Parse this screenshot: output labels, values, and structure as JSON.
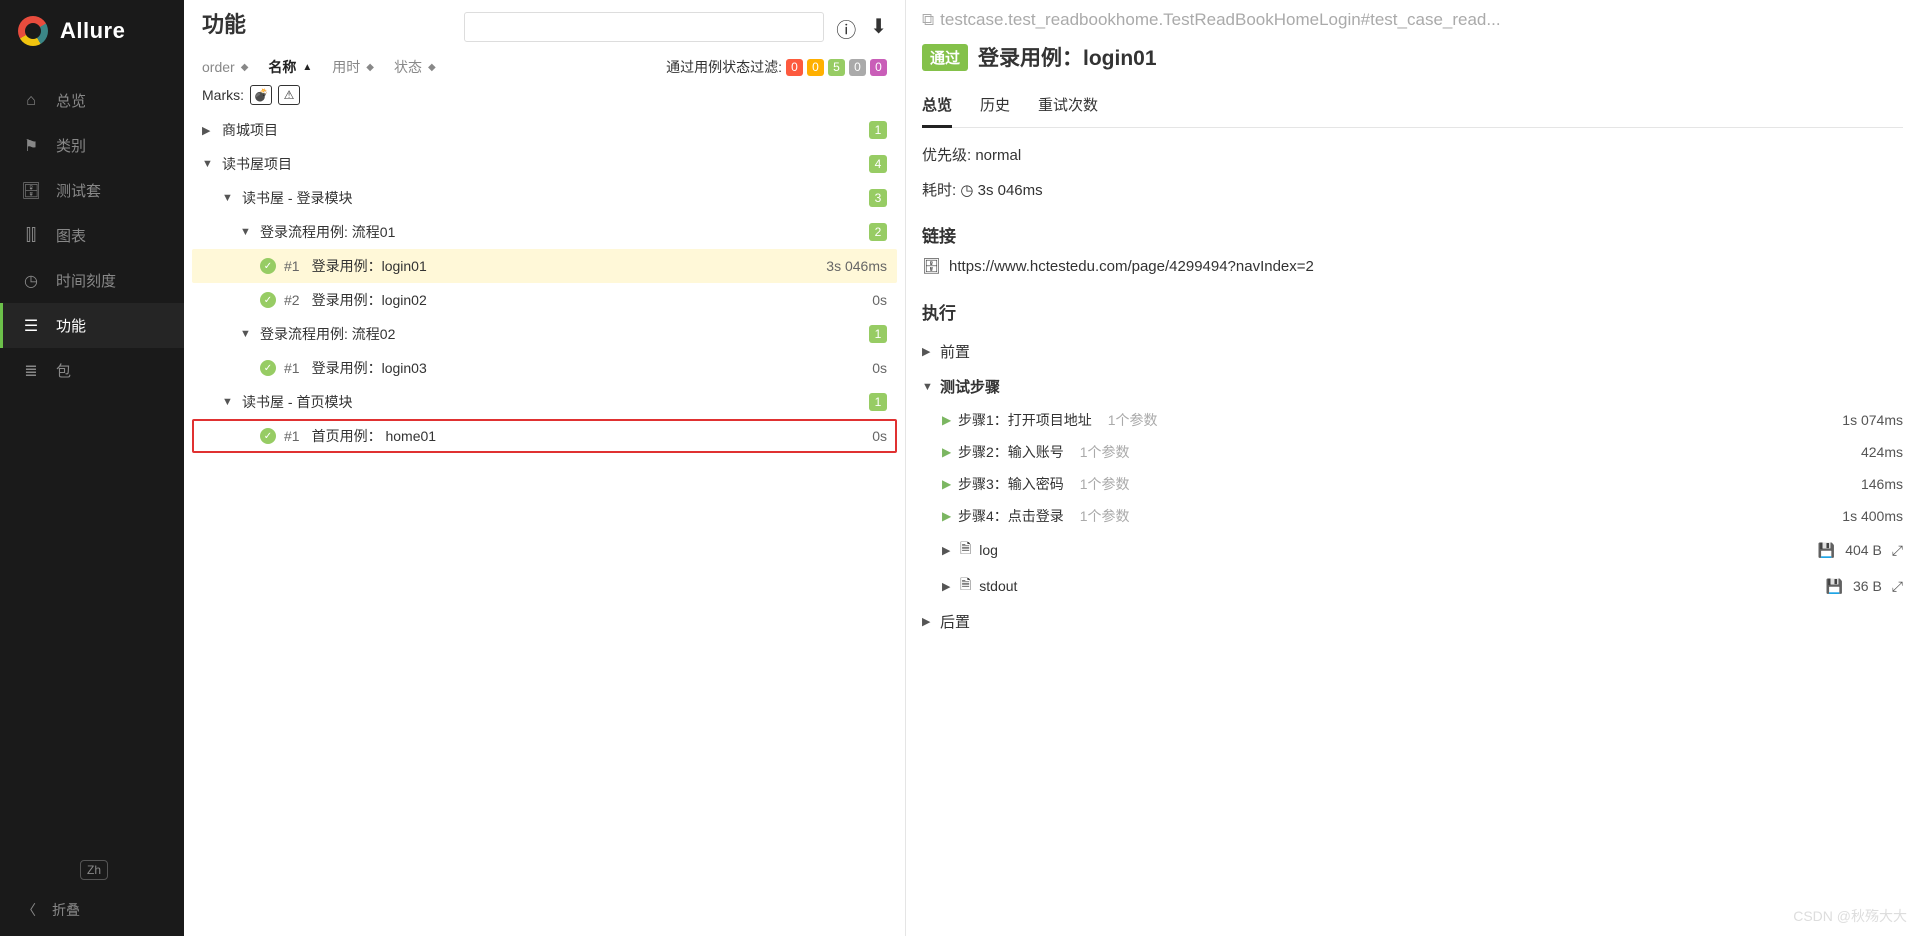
{
  "sidebar": {
    "brand": "Allure",
    "items": [
      {
        "label": "总览",
        "icon": "home"
      },
      {
        "label": "类别",
        "icon": "flag"
      },
      {
        "label": "测试套",
        "icon": "case"
      },
      {
        "label": "图表",
        "icon": "chart"
      },
      {
        "label": "时间刻度",
        "icon": "clock"
      },
      {
        "label": "功能",
        "icon": "list",
        "active": true
      },
      {
        "label": "包",
        "icon": "stack"
      }
    ],
    "lang": "Zh",
    "collapse": "折叠"
  },
  "mid": {
    "title": "功能",
    "sort": {
      "order": "order",
      "name": "名称",
      "duration": "用时",
      "status": "状态"
    },
    "filter": {
      "label": "通过用例状态过滤:",
      "counts": [
        "0",
        "0",
        "5",
        "0",
        "0"
      ]
    },
    "marks_label": "Marks:",
    "tree": {
      "n0": {
        "name": "商城项目",
        "badge": "1"
      },
      "n1": {
        "name": "读书屋项目",
        "badge": "4"
      },
      "n2": {
        "name": "读书屋 - 登录模块",
        "badge": "3"
      },
      "n3": {
        "name": "登录流程用例: 流程01",
        "badge": "2"
      },
      "n4": {
        "num": "#1",
        "name": "登录用例：login01",
        "meta": "3s 046ms"
      },
      "n5": {
        "num": "#2",
        "name": "登录用例：login02",
        "meta": "0s"
      },
      "n6": {
        "name": "登录流程用例: 流程02",
        "badge": "1"
      },
      "n7": {
        "num": "#1",
        "name": "登录用例：login03",
        "meta": "0s"
      },
      "n8": {
        "name": "读书屋 - 首页模块",
        "badge": "1"
      },
      "n9": {
        "num": "#1",
        "name": "首页用例： home01",
        "meta": "0s"
      }
    }
  },
  "right": {
    "breadcrumb": "testcase.test_readbookhome.TestReadBookHomeLogin#test_case_read...",
    "status": "通过",
    "title": "登录用例：login01",
    "tabs": {
      "overview": "总览",
      "history": "历史",
      "retries": "重试次数"
    },
    "priority_label": "优先级:",
    "priority_value": "normal",
    "duration_label": "耗时:",
    "duration_value": "3s 046ms",
    "links_h": "链接",
    "link_url": "https://www.hctestedu.com/page/4299494?navIndex=2",
    "exec_h": "执行",
    "before": "前置",
    "steps_h": "测试步骤",
    "steps": [
      {
        "name": "步骤1：打开项目地址",
        "param": "1个参数",
        "time": "1s 074ms"
      },
      {
        "name": "步骤2：输入账号",
        "param": "1个参数",
        "time": "424ms"
      },
      {
        "name": "步骤3：输入密码",
        "param": "1个参数",
        "time": "146ms"
      },
      {
        "name": "步骤4：点击登录",
        "param": "1个参数",
        "time": "1s 400ms"
      }
    ],
    "attachments": [
      {
        "name": "log",
        "size": "404 B"
      },
      {
        "name": "stdout",
        "size": "36 B"
      }
    ],
    "after": "后置"
  },
  "watermark": "CSDN @秋殇大大"
}
